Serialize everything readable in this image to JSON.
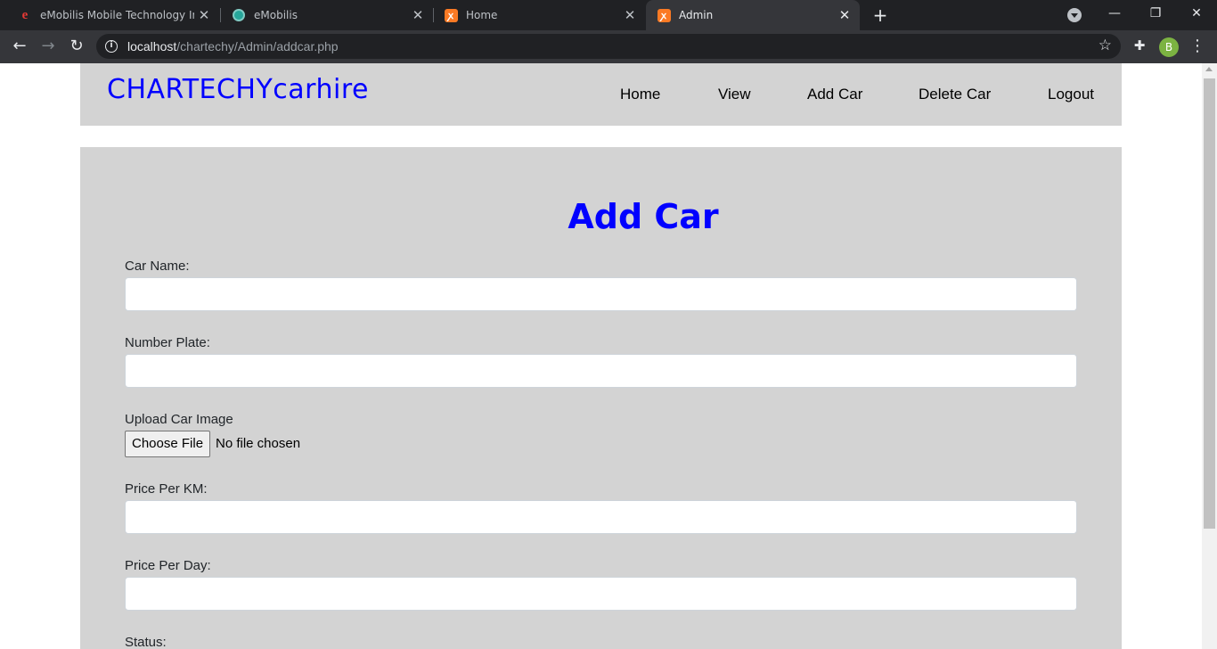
{
  "browser": {
    "tabs": [
      {
        "title": "eMobilis Mobile Technology Institute",
        "icon": "emobilis-e-icon",
        "active": false
      },
      {
        "title": "eMobilis",
        "icon": "globe-icon",
        "active": false
      },
      {
        "title": "Home",
        "icon": "xampp-icon",
        "active": false
      },
      {
        "title": "Admin",
        "icon": "xampp-icon",
        "active": true
      }
    ],
    "url_host": "localhost",
    "url_path": "/chartechy/Admin/addcar.php",
    "profile_initial": "B",
    "colors": {
      "tab_bar": "#202124",
      "toolbar": "#35363a",
      "profile": "#7cb342"
    }
  },
  "site": {
    "logo": "CHARTECHYcarhire",
    "nav": [
      "Home",
      "View",
      "Add Car",
      "Delete Car",
      "Logout"
    ],
    "colors": {
      "header_bg": "#d3d3d3",
      "brand": "#0000ff"
    }
  },
  "form": {
    "title": "Add Car",
    "car_name_label": "Car Name:",
    "car_name_value": "",
    "number_plate_label": "Number Plate:",
    "number_plate_value": "",
    "image_label": "Upload Car Image",
    "file_button": "Choose File",
    "file_status": "No file chosen",
    "price_km_label": "Price Per KM:",
    "price_km_value": "",
    "price_day_label": "Price Per Day:",
    "price_day_value": "",
    "status_label": "Status:"
  }
}
